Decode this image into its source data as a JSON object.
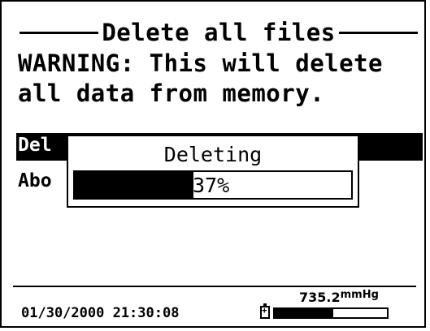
{
  "screen": {
    "title": "Delete all files",
    "warning_line1": "WARNING: This will delete",
    "warning_line2": "all data from memory."
  },
  "menu": {
    "items": [
      {
        "label": "Del",
        "selected": true
      },
      {
        "label": "Abo",
        "selected": false
      }
    ]
  },
  "dialog": {
    "title": "Deleting",
    "progress_fraction": 0.43,
    "progress_text": "37%"
  },
  "status": {
    "pressure_value": "735.2",
    "pressure_unit": "mmHg",
    "datetime": "01/30/2000 21:30:08",
    "battery_icon": "battery-icon",
    "battery_fraction": 0.52
  },
  "colors": {
    "background": "#ffffff",
    "foreground": "#000000"
  }
}
